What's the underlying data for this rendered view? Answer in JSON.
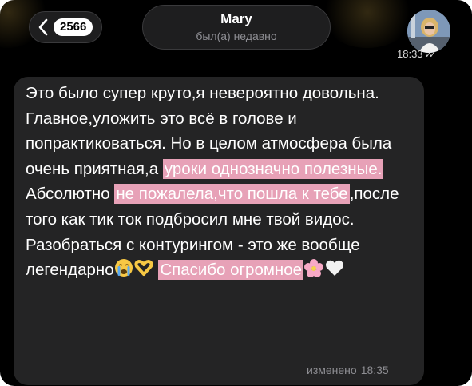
{
  "header": {
    "back_badge": "2566",
    "contact_name": "Mary",
    "contact_status": "был(а) недавно",
    "time": "18:33"
  },
  "message": {
    "seg1": "Это было супер круто,я невероятно довольна. Главное,уложить это всё в голове и попрактиковаться. Но в целом атмосфера была очень приятная,а ",
    "hl1": "уроки однозначно полезные.",
    "seg2": " Абсолютно ",
    "hl2": "не пожалела,что пошла к тебе",
    "seg3": ",после того как тик ток подбросил мне твой видос. Разобраться с контурингом - это же вообще легендарно",
    "hl3": "Спасибо огромное",
    "edited_label": "изменено",
    "edited_time": "18:35"
  },
  "icons": [
    "back-chevron-icon",
    "read-checkmark-icon",
    "crying-face-emoji",
    "heart-hands-emoji",
    "cherry-blossom-emoji",
    "white-heart-emoji"
  ],
  "colors": {
    "background": "#000000",
    "bubble": "#242425",
    "highlight": "#e7a1b7",
    "secondary_text": "#8e8e93"
  }
}
